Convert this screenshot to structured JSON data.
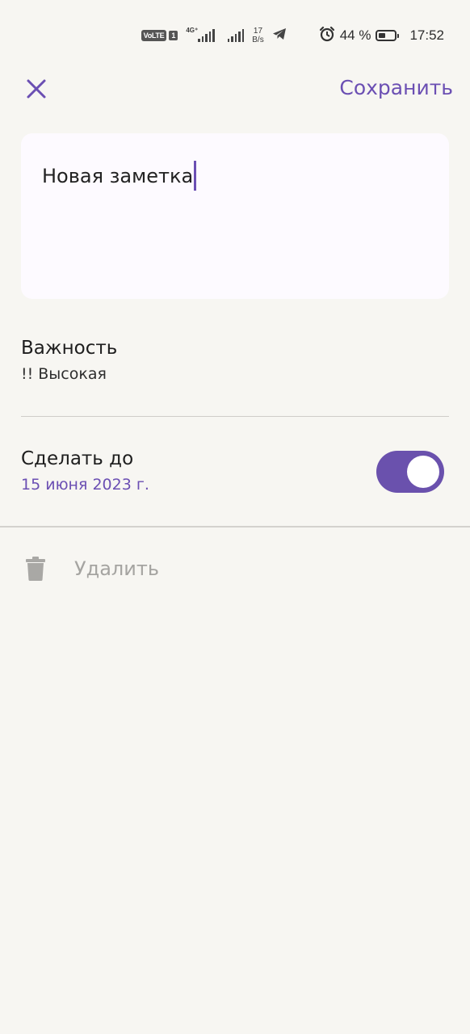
{
  "status_bar": {
    "volte": "VoLTE",
    "sim": "1",
    "network": "4G⁺",
    "speed_value": "17",
    "speed_unit": "B/s",
    "battery_percent": "44 %",
    "battery_level": 0.44,
    "time": "17:52"
  },
  "toolbar": {
    "close_icon": "close-icon",
    "save_label": "Сохранить"
  },
  "note": {
    "text": "Новая заметка"
  },
  "importance": {
    "title": "Важность",
    "value": "!! Высокая"
  },
  "deadline": {
    "title": "Сделать до",
    "date": "15 июня 2023 г.",
    "enabled": true
  },
  "delete": {
    "icon": "trash-icon",
    "label": "Удалить"
  },
  "colors": {
    "accent": "#6b4fb3",
    "background": "#f7f6f2",
    "card": "#fdfaff",
    "disabled_text": "#a5a4a1"
  }
}
